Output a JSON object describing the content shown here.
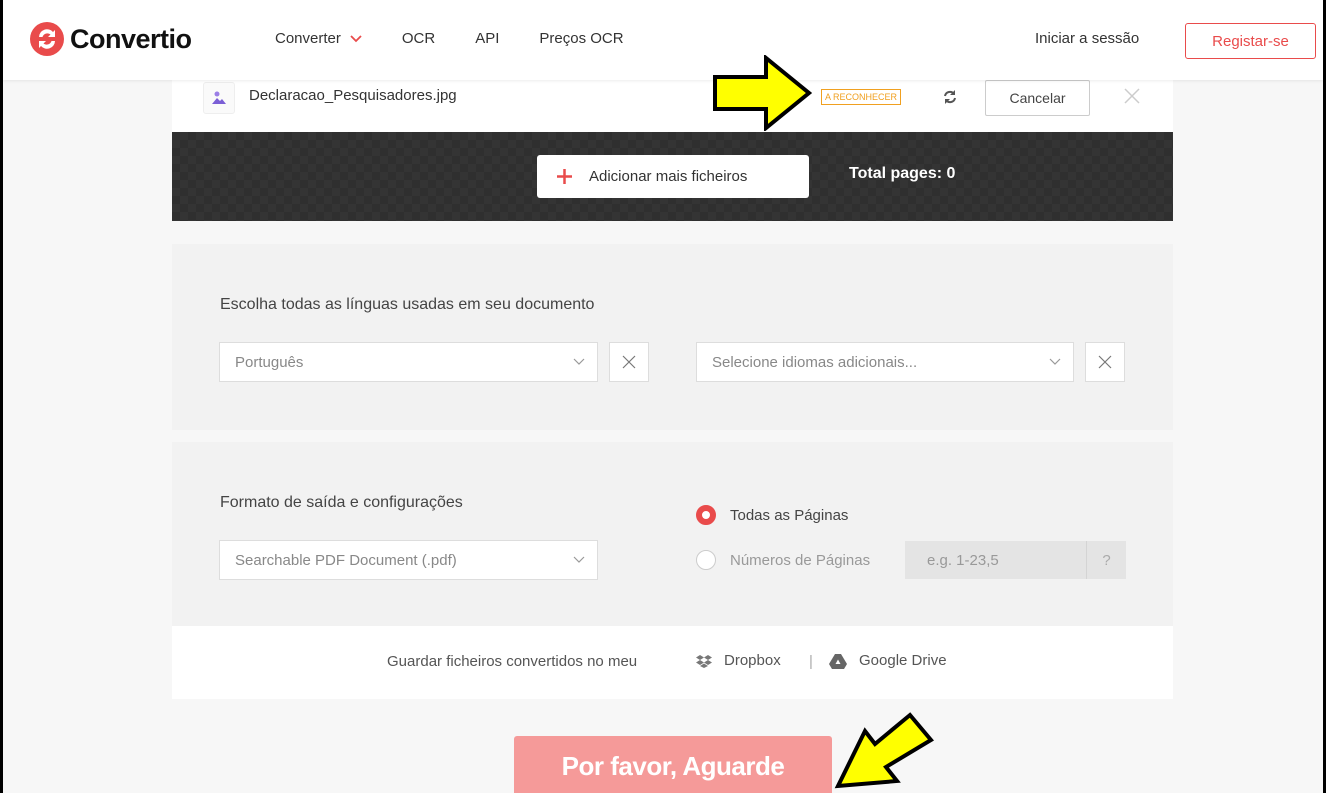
{
  "header": {
    "brand": "Convertio",
    "nav": [
      {
        "label": "Converter",
        "has_dropdown": true
      },
      {
        "label": "OCR"
      },
      {
        "label": "API"
      },
      {
        "label": "Preços OCR"
      }
    ],
    "login": "Iniciar a sessão",
    "signup": "Registar-se"
  },
  "file": {
    "name": "Declaracao_Pesquisadores.jpg",
    "status": "A RECONHECER",
    "cancel": "Cancelar"
  },
  "toolbar": {
    "add_files": "Adicionar mais ficheiros",
    "total_pages": "Total pages: 0"
  },
  "languages": {
    "title": "Escolha todas as línguas usadas em seu documento",
    "primary": "Português",
    "additional_placeholder": "Selecione idiomas adicionais..."
  },
  "output": {
    "title": "Formato de saída e configurações",
    "format": "Searchable PDF Document (.pdf)",
    "all_pages": "Todas as Páginas",
    "page_numbers": "Números de Páginas",
    "page_numbers_placeholder": "e.g. 1-23,5",
    "help": "?",
    "selected_option": "all_pages"
  },
  "save": {
    "text": "Guardar ficheiros convertidos no meu",
    "dropbox": "Dropbox",
    "separator": "|",
    "gdrive": "Google Drive"
  },
  "action": {
    "wait": "Por favor, Aguarde"
  },
  "colors": {
    "accent": "#e94b4b",
    "status": "#f0a020",
    "button_disabled": "#f59a99",
    "annotation_arrow": "#ffff00"
  }
}
